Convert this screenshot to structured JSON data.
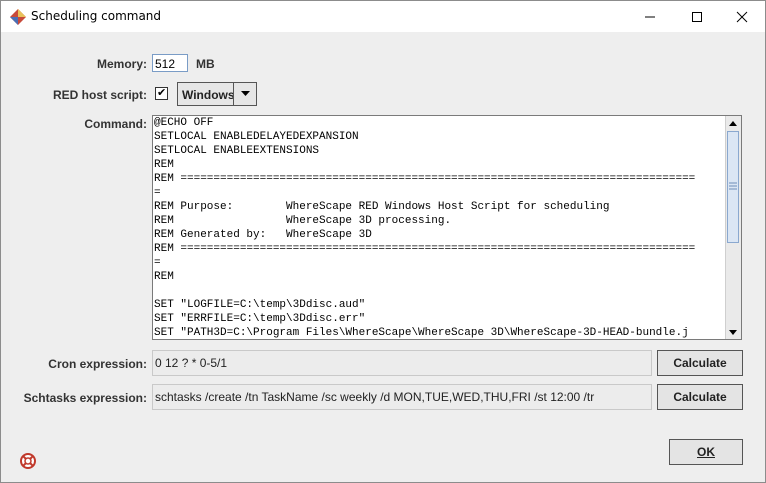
{
  "window": {
    "title": "Scheduling command",
    "icon": "app-logo-icon",
    "controls": [
      "minimize-icon",
      "maximize-icon",
      "close-icon"
    ]
  },
  "memory": {
    "label": "Memory:",
    "value": "512",
    "unit": "MB"
  },
  "host_script": {
    "label": "RED host script:",
    "checked": true,
    "check_glyph": "✔",
    "selected": "Windows"
  },
  "command": {
    "label": "Command:",
    "text": "@ECHO OFF\nSETLOCAL ENABLEDELAYEDEXPANSION\nSETLOCAL ENABLEEXTENSIONS\nREM\nREM ==============================================================================\n=\nREM Purpose:        WhereScape RED Windows Host Script for scheduling\nREM                 WhereScape 3D processing.\nREM Generated by:   WhereScape 3D\nREM ==============================================================================\n=\nREM\n\nSET \"LOGFILE=C:\\temp\\3Ddisc.aud\"\nSET \"ERRFILE=C:\\temp\\3Ddisc.err\"\nSET \"PATH3D=C:\\Program Files\\WhereScape\\WhereScape 3D\\WhereScape-3D-HEAD-bundle.j"
  },
  "cron": {
    "label": "Cron expression:",
    "value": "0 12 ? * 0-5/1",
    "button": "Calculate"
  },
  "schtasks": {
    "label": "Schtasks expression:",
    "value": "schtasks /create /tn TaskName /sc weekly /d MON,TUE,WED,THU,FRI /st 12:00 /tr",
    "button": "Calculate"
  },
  "footer": {
    "ok_label": "OK",
    "help_icon": "help-lifebuoy-icon"
  }
}
